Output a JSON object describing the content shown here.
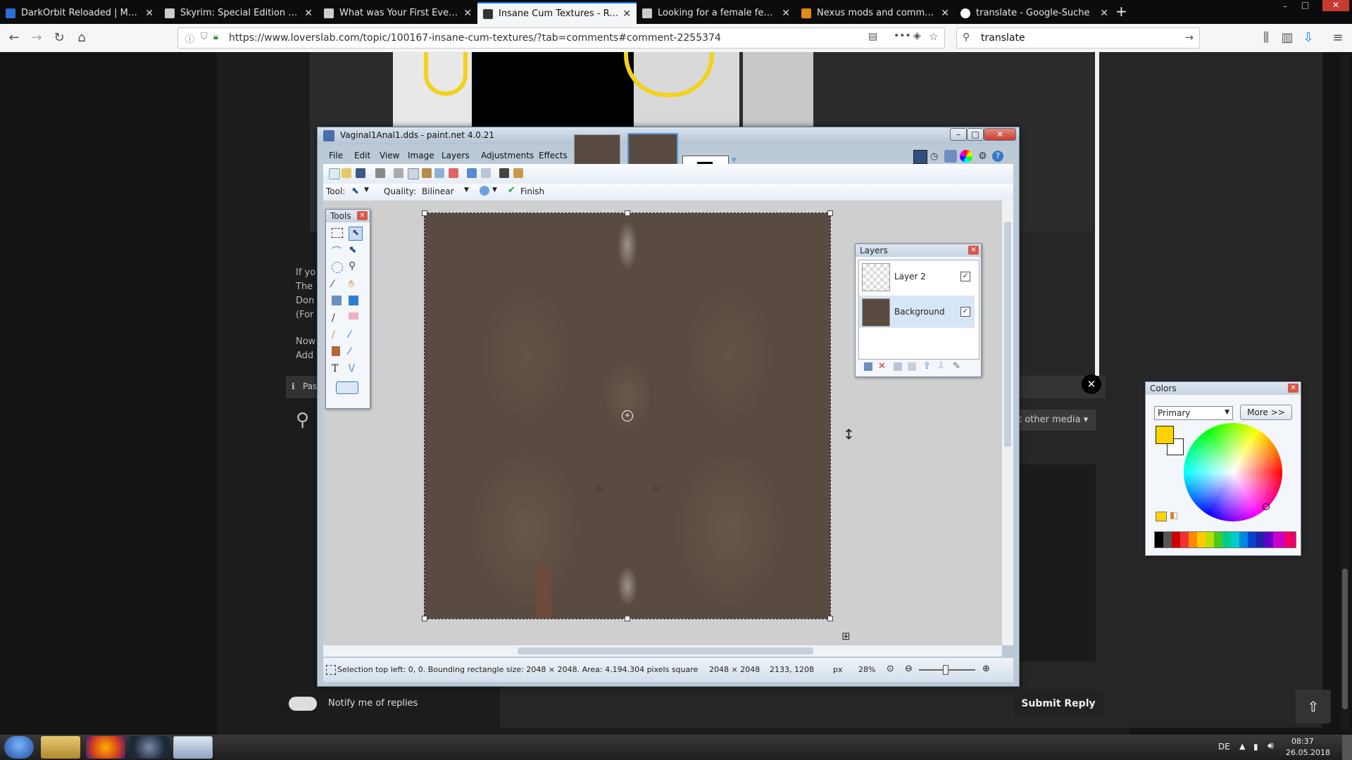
{
  "browser": {
    "tabs": [
      {
        "label": "DarkOrbit Reloaded | MMO & Sp",
        "close": "✕"
      },
      {
        "label": "Skyrim: Special Edition - Lovers",
        "close": "✕"
      },
      {
        "label": "What was Your First Ever Comp",
        "close": "✕"
      },
      {
        "label": "Insane Cum Textures - Request",
        "close": "✕",
        "active": true
      },
      {
        "label": "Looking for a female feet mod",
        "close": "✕"
      },
      {
        "label": "Nexus mods and community",
        "close": "✕"
      },
      {
        "label": "translate - Google-Suche",
        "close": "✕"
      }
    ],
    "new_tab": "+",
    "url": "https://www.loverslab.com/topic/100167-insane-cum-textures/?tab=comments#comment-2255374",
    "search_value": "translate"
  },
  "page": {
    "text_lines": [
      "If yo",
      "The",
      "Don",
      "(For",
      "Now",
      "Add"
    ],
    "info_text": "Pas",
    "media_button": "rt other media ▾",
    "notify_label": "Notify me of replies",
    "submit_label": "Submit Reply",
    "close_glyph": "✕"
  },
  "paintnet": {
    "title": "Vaginal1Anal1.dds - paint.net 4.0.21",
    "menus": [
      "File",
      "Edit",
      "View",
      "Image",
      "Layers",
      "Adjustments",
      "Effects"
    ],
    "tool_label": "Tool:",
    "quality_label": "Quality:",
    "quality_value": "Bilinear",
    "finish_label": "Finish",
    "status_text": "Selection top left: 0, 0. Bounding rectangle size: 2048 × 2048. Area: 4.194.304 pixels square",
    "image_size": "2048 × 2048",
    "cursor_pos": "2133, 1208",
    "unit": "px",
    "zoom": "28%",
    "win_buttons": [
      "–",
      "□",
      "✕"
    ]
  },
  "tools_panel": {
    "title": "Tools"
  },
  "layers_panel": {
    "title": "Layers",
    "layers": [
      {
        "name": "Layer 2",
        "visible": true
      },
      {
        "name": "Background",
        "visible": true,
        "selected": true
      }
    ],
    "check": "✓"
  },
  "colors_panel": {
    "title": "Colors",
    "mode": "Primary",
    "more_button": "More >>",
    "primary_color": "#ffd400",
    "secondary_color": "#ffffff"
  },
  "taskbar": {
    "lang": "DE",
    "time": "08:37",
    "date": "26.05.2018"
  }
}
